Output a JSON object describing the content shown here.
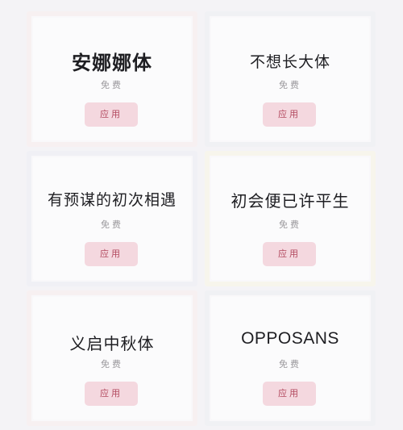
{
  "fonts": [
    {
      "name": "安娜娜体",
      "price": "免费",
      "button": "应用"
    },
    {
      "name": "不想长大体",
      "price": "免费",
      "button": "应用"
    },
    {
      "name": "有预谋的初次相遇",
      "price": "免费",
      "button": "应用"
    },
    {
      "name": "初会便已许平生",
      "price": "免费",
      "button": "应用"
    },
    {
      "name": "义启中秋体",
      "price": "免费",
      "button": "应用"
    },
    {
      "name": "OPPOSANS",
      "price": "免费",
      "button": "应用"
    }
  ],
  "colors": {
    "background": "#f4f3f6",
    "button_bg": "#f4d8df",
    "button_text": "#b2485e",
    "price_text": "#9a989c"
  }
}
